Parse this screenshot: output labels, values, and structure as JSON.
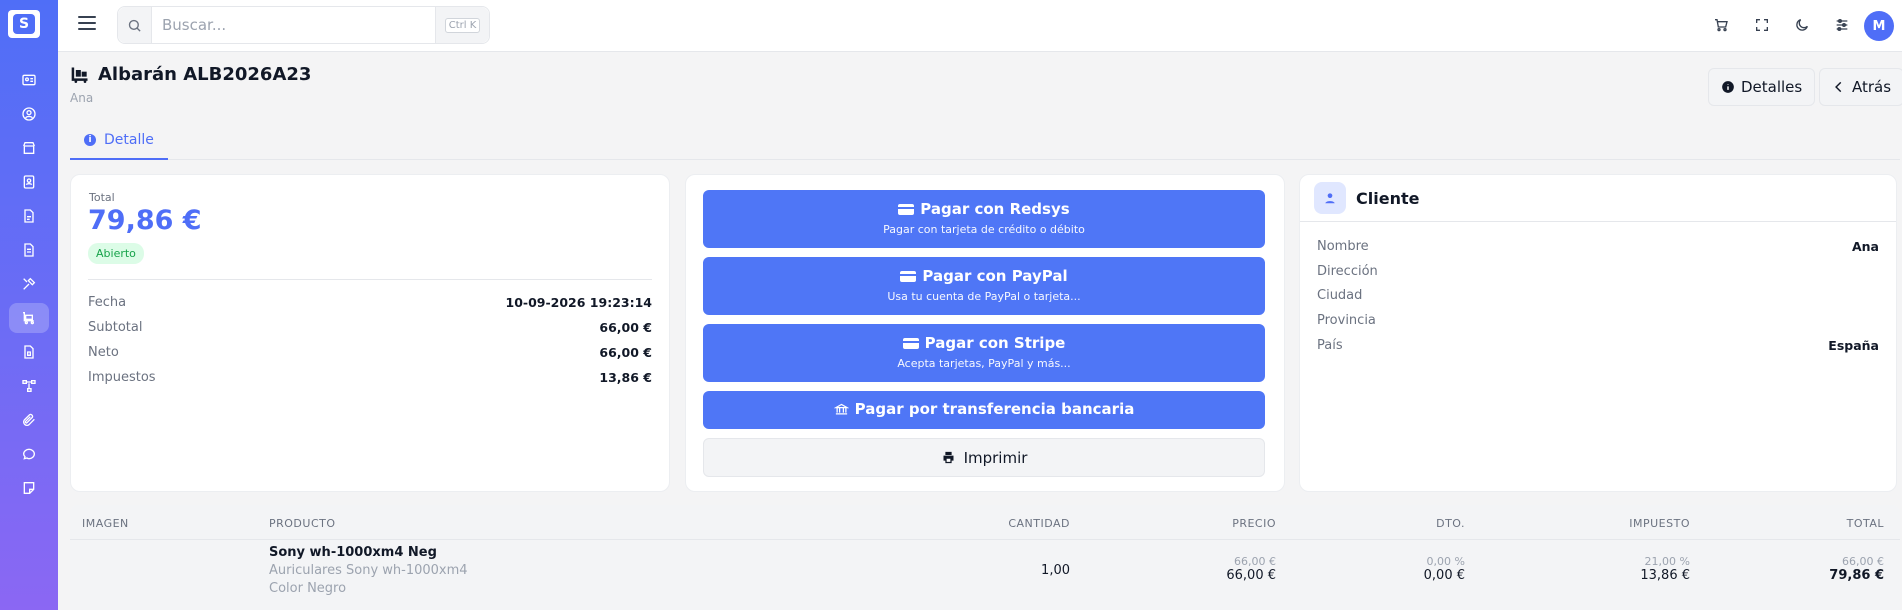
{
  "topbar": {
    "search_placeholder": "Buscar...",
    "search_shortcut": "Ctrl K",
    "avatar_initial": "M"
  },
  "header": {
    "title": "Albarán ALB2026A23",
    "subtitle": "Ana",
    "details_button": "Detalles",
    "back_button": "Atrás"
  },
  "tabs": [
    {
      "label": "Detalle"
    }
  ],
  "summary": {
    "total_label": "Total",
    "total_value": "79,86 €",
    "status": "Abierto",
    "rows": [
      {
        "key": "Fecha",
        "value": "10-09-2026 19:23:14"
      },
      {
        "key": "Subtotal",
        "value": "66,00 €"
      },
      {
        "key": "Neto",
        "value": "66,00 €"
      },
      {
        "key": "Impuestos",
        "value": "13,86 €"
      }
    ]
  },
  "payments": {
    "redsys": {
      "label": "Pagar con Redsys",
      "sub": "Pagar con tarjeta de crédito o débito"
    },
    "paypal": {
      "label": "Pagar con PayPal",
      "sub": "Usa tu cuenta de PayPal o tarjeta..."
    },
    "stripe": {
      "label": "Pagar con Stripe",
      "sub": "Acepta tarjetas, PayPal y más..."
    },
    "transfer": {
      "label": "Pagar por transferencia bancaria"
    },
    "print": {
      "label": "Imprimir"
    }
  },
  "client": {
    "title": "Cliente",
    "rows": [
      {
        "key": "Nombre",
        "value": "Ana"
      },
      {
        "key": "Dirección",
        "value": ""
      },
      {
        "key": "Ciudad",
        "value": ""
      },
      {
        "key": "Provincia",
        "value": ""
      },
      {
        "key": "País",
        "value": "España"
      }
    ]
  },
  "table": {
    "headers": [
      "IMAGEN",
      "PRODUCTO",
      "CANTIDAD",
      "PRECIO",
      "DTO.",
      "IMPUESTO",
      "TOTAL"
    ],
    "rows": [
      {
        "name": "Sony wh-1000xm4 Neg",
        "desc1": "Auriculares Sony wh-1000xm4",
        "desc2": "Color Negro",
        "quantity": "1,00",
        "price_top": "66,00 €",
        "price": "66,00 €",
        "discount_top": "0,00 %",
        "discount": "0,00 €",
        "tax_top": "21,00 %",
        "tax": "13,86 €",
        "total_top": "66,00 €",
        "total": "79,86 €"
      }
    ]
  },
  "colors": {
    "accent": "#4f6ef7",
    "success": "#16a34a"
  }
}
